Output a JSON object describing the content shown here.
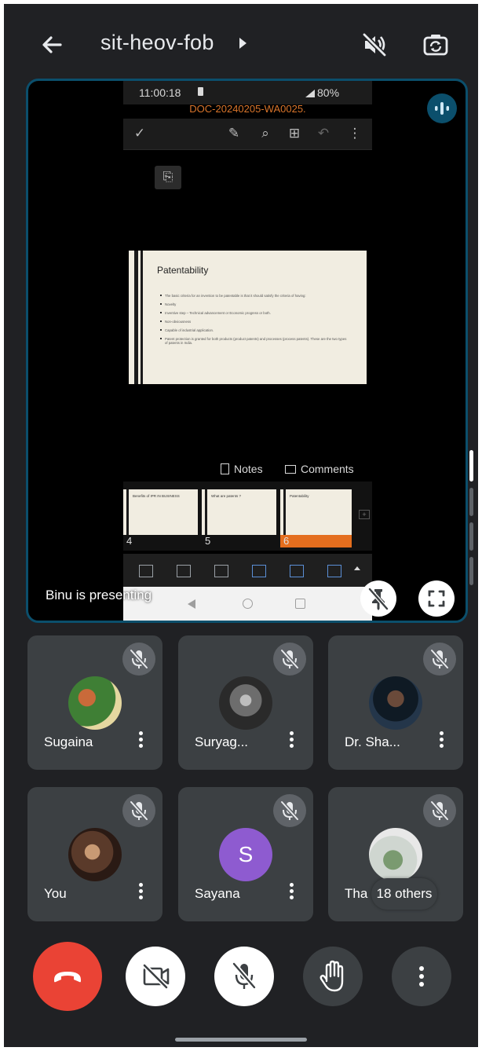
{
  "header": {
    "meeting_title": "sit-heov-fob"
  },
  "presentation": {
    "status_time": "11:00:18",
    "status_battery": "80%",
    "doc_name": "DOC-20240205-WA0025.",
    "slide": {
      "title": "Patentability",
      "bullets": [
        "The basic criteria for an invention to be patentable is that it should satisfy the criteria of having:",
        "Novelty",
        "Inventive step – Technical advancement or Economic progress or both.",
        "Non-obviousness",
        "Capable of industrial application.",
        "Patent protection is granted for both products (product patents) and processes (process patents). These are the two types of patents in India."
      ]
    },
    "notes_label": "Notes",
    "comments_label": "Comments",
    "thumbnails": [
      {
        "num": "4",
        "title": "Benefits of IPR IN BUSINESS",
        "active": false
      },
      {
        "num": "5",
        "title": "What are patents ?",
        "active": false
      },
      {
        "num": "6",
        "title": "Patentability",
        "active": true
      }
    ],
    "presenting_label": "Binu is presenting"
  },
  "participants": [
    {
      "name": "Sugaina",
      "type": "photo",
      "colors": [
        "#3f7f35",
        "#c96a3a",
        "#e5d7a0"
      ]
    },
    {
      "name": "Suryag...",
      "type": "photo",
      "colors": [
        "#2a2a2a",
        "#6d6d6d",
        "#bdbdbd"
      ]
    },
    {
      "name": "Dr. Sha...",
      "type": "photo",
      "colors": [
        "#0f1a24",
        "#6a4a3a",
        "#24364a"
      ]
    },
    {
      "name": "You",
      "type": "photo",
      "colors": [
        "#5a3a2a",
        "#c89a74",
        "#2a1a14"
      ]
    },
    {
      "name": "Sayana",
      "type": "letter",
      "letter": "S",
      "colors": [
        "#8e5bd0"
      ]
    },
    {
      "name": "Tha",
      "type": "photo",
      "colors": [
        "#cfd6d0",
        "#7a9a70",
        "#e8e8e8"
      ]
    }
  ],
  "others_label": "18 others",
  "colors": {
    "background": "#202124",
    "tile": "#3c4043",
    "end_call": "#ea4335",
    "presentation_border": "#0b4f6c",
    "accent_orange": "#e46e1e"
  },
  "icons": {
    "back": "arrow-left-icon",
    "speaker": "speaker-off-icon",
    "camera_flip": "camera-flip-icon",
    "audio": "audio-level-icon",
    "unpin": "pin-off-icon",
    "fullscreen": "fullscreen-icon",
    "mic_off": "mic-off-icon",
    "end_call": "phone-hangup-icon",
    "camera_off": "videocam-off-icon",
    "raise_hand": "hand-icon",
    "more": "more-vert-icon"
  }
}
